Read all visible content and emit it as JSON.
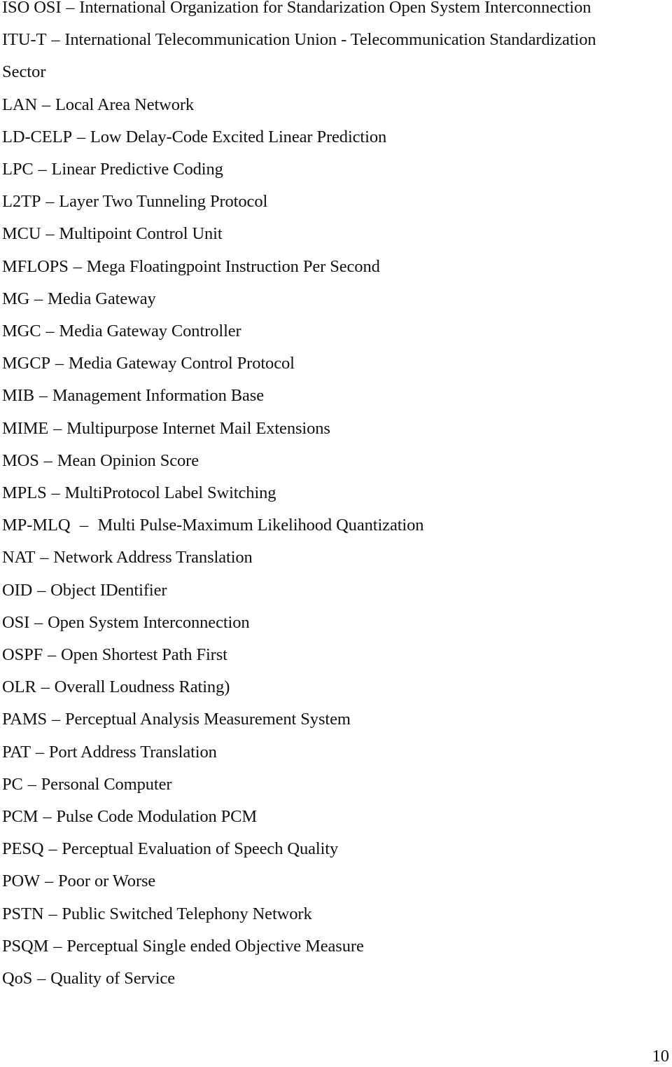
{
  "document": {
    "type": "list of abbreviations",
    "separator": "–",
    "entries": [
      {
        "abbr": "ISO OSI",
        "expansion": "International Organization for Standarization Open System Interconnection"
      },
      {
        "abbr": "ITU-T",
        "expansion": "International Telecommunication Union - Telecommunication Standardization"
      },
      {
        "abbr": "",
        "expansion": "Sector"
      },
      {
        "abbr": "LAN",
        "expansion": "Local Area Network"
      },
      {
        "abbr": "LD-CELP",
        "expansion": "Low Delay-Code Excited Linear Prediction"
      },
      {
        "abbr": "LPC",
        "expansion": "Linear Predictive Coding"
      },
      {
        "abbr": "L2TP",
        "expansion": "Layer Two Tunneling Protocol"
      },
      {
        "abbr": "MCU",
        "expansion": "Multipoint Control Unit"
      },
      {
        "abbr": "MFLOPS",
        "expansion": "Mega Floatingpoint Instruction Per Second"
      },
      {
        "abbr": "MG",
        "expansion": "Media Gateway"
      },
      {
        "abbr": "MGC",
        "expansion": "Media Gateway Controller"
      },
      {
        "abbr": "MGCP",
        "expansion": "Media Gateway Control Protocol"
      },
      {
        "abbr": "MIB",
        "expansion": "Management Information Base"
      },
      {
        "abbr": "MIME",
        "expansion": "Multipurpose Internet Mail Extensions"
      },
      {
        "abbr": "MOS",
        "expansion": "Mean Opinion Score"
      },
      {
        "abbr": "MPLS",
        "expansion": "MultiProtocol Label Switching"
      },
      {
        "abbr": "MP-MLQ",
        "expansion": "Multi Pulse-Maximum Likelihood Quantization"
      },
      {
        "abbr": "NAT",
        "expansion": "Network Address Translation"
      },
      {
        "abbr": "OID",
        "expansion": "Object IDentifier"
      },
      {
        "abbr": "OSI",
        "expansion": "Open System Interconnection"
      },
      {
        "abbr": "OSPF",
        "expansion": "Open Shortest Path First"
      },
      {
        "abbr": "OLR",
        "expansion": "Overall Loudness Rating)"
      },
      {
        "abbr": "PAMS",
        "expansion": "Perceptual Analysis Measurement System"
      },
      {
        "abbr": "PAT",
        "expansion": "Port Address Translation"
      },
      {
        "abbr": "PC",
        "expansion": "Personal Computer"
      },
      {
        "abbr": "PCM",
        "expansion": "Pulse Code Modulation PCM"
      },
      {
        "abbr": "PESQ",
        "expansion": "Perceptual Evaluation of Speech Quality"
      },
      {
        "abbr": "POW",
        "expansion": "Poor or Worse"
      },
      {
        "abbr": "PSTN",
        "expansion": "Public Switched Telephony Network"
      },
      {
        "abbr": "PSQM",
        "expansion": "Perceptual Single ended Objective Measure"
      },
      {
        "abbr": "QoS",
        "expansion": "Quality of Service"
      }
    ],
    "page_number": "10"
  }
}
